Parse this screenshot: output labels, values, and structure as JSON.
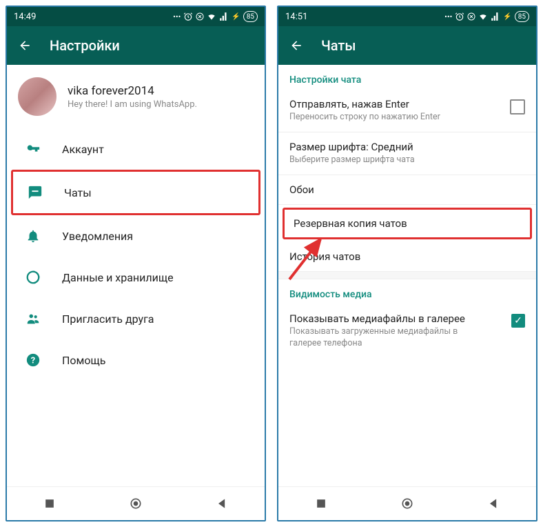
{
  "left": {
    "statusbar": {
      "time": "14:49",
      "battery": "85"
    },
    "appbar": {
      "title": "Настройки"
    },
    "profile": {
      "name": "vika forever2014",
      "status": "Hey there! I am using WhatsApp."
    },
    "menu": {
      "account": "Аккаунт",
      "chats": "Чаты",
      "notifications": "Уведомления",
      "dataStorage": "Данные и хранилище",
      "inviteFriend": "Пригласить друга",
      "help": "Помощь"
    }
  },
  "right": {
    "statusbar": {
      "time": "14:51",
      "battery": "85"
    },
    "appbar": {
      "title": "Чаты"
    },
    "section1": {
      "header": "Настройки чата"
    },
    "enterToSend": {
      "title": "Отправлять, нажав Enter",
      "sub": "Переносить строку по нажатию Enter"
    },
    "fontSize": {
      "title": "Размер шрифта: Средний",
      "sub": "Выберите размер шрифта чата"
    },
    "wallpaper": {
      "title": "Обои"
    },
    "backup": {
      "title": "Резервная копия чатов"
    },
    "history": {
      "title": "История чатов"
    },
    "section2": {
      "header": "Видимость медиа"
    },
    "mediaVisibility": {
      "title": "Показывать медиафайлы в галерее",
      "sub": "Показывать загруженные медиафайлы в галерее телефона"
    }
  }
}
